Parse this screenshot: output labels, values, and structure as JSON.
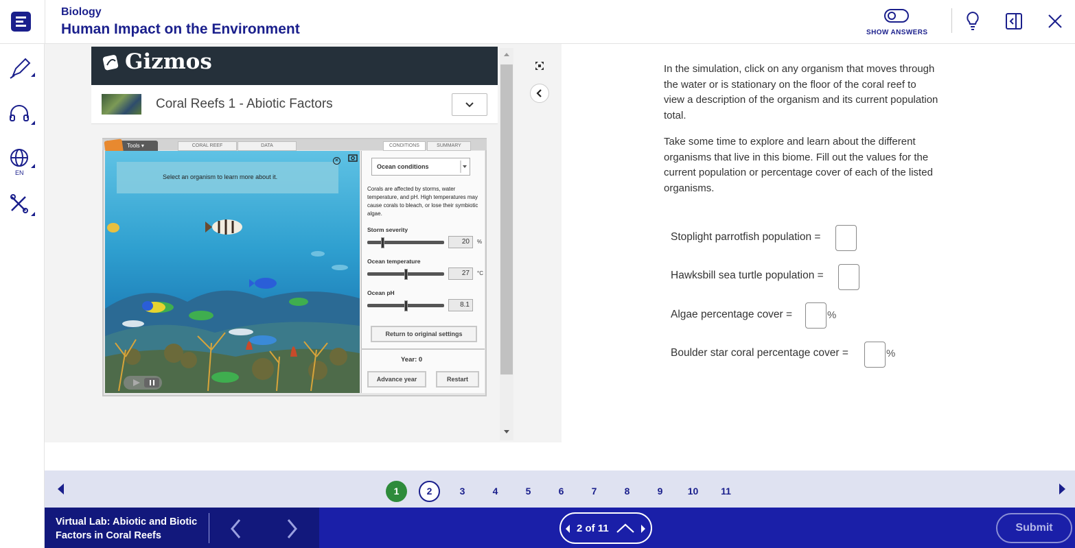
{
  "header": {
    "subject": "Biology",
    "lesson_title": "Human Impact on the Environment",
    "show_answers_label": "SHOW ANSWERS",
    "icons": [
      "logo-icon",
      "toggle-icon",
      "lightbulb-icon",
      "sidebar-collapse-icon",
      "close-icon"
    ]
  },
  "rail": {
    "icons": [
      "highlighter-icon",
      "headphones-icon",
      "globe-icon",
      "tools-icon"
    ],
    "language": "EN"
  },
  "gizmo": {
    "brand": "Gizmos",
    "name": "Coral Reefs 1 - Abiotic Factors",
    "sim": {
      "tools_label": "Tools",
      "tabs": [
        "CORAL REEF",
        "DATA",
        "CONDITIONS",
        "SUMMARY"
      ],
      "info_text": "Select an organism to learn more about it.",
      "conditions_select": "Ocean conditions",
      "conditions_desc": "Corals are affected by storms, water temperature, and pH. High temperatures may cause corals to bleach, or lose their symbiotic algae.",
      "sliders": [
        {
          "label": "Storm severity",
          "value": "20",
          "unit": "%",
          "level": 0.2
        },
        {
          "label": "Ocean temperature",
          "value": "27",
          "unit": "°C",
          "level": 0.5
        },
        {
          "label": "Ocean pH",
          "value": "8.1",
          "unit": "",
          "level": 0.5
        }
      ],
      "return_label": "Return to original settings",
      "year_label": "Year: 0",
      "advance_label": "Advance year",
      "restart_label": "Restart"
    }
  },
  "content": {
    "para1": "In the simulation, click on any organism that moves through the water or is stationary on the floor of the coral reef to view a description of the organism and its current population total.",
    "para2": "Take some time to explore and learn about the different organisms that live in this biome. Fill out the values for the current population or percentage cover of each of the listed organisms.",
    "questions": [
      {
        "label": "Stoplight parrotfish population =",
        "suffix": ""
      },
      {
        "label": "Hawksbill sea turtle population =",
        "suffix": ""
      },
      {
        "label": "Algae percentage cover =",
        "suffix": "%"
      },
      {
        "label": "Boulder star coral percentage cover =",
        "suffix": "%"
      }
    ]
  },
  "pager": {
    "pages": [
      "1",
      "2",
      "3",
      "4",
      "5",
      "6",
      "7",
      "8",
      "9",
      "10",
      "11"
    ],
    "completed": "1",
    "current": "2"
  },
  "footer": {
    "activity_title": "Virtual Lab: Abiotic and Biotic Factors in Coral Reefs",
    "progress": "2 of 11",
    "submit_label": "Submit"
  },
  "colors": {
    "brand_navy": "#1a1f8c",
    "footer_blue": "#1a1fa8",
    "done_green": "#2e8b3b"
  }
}
